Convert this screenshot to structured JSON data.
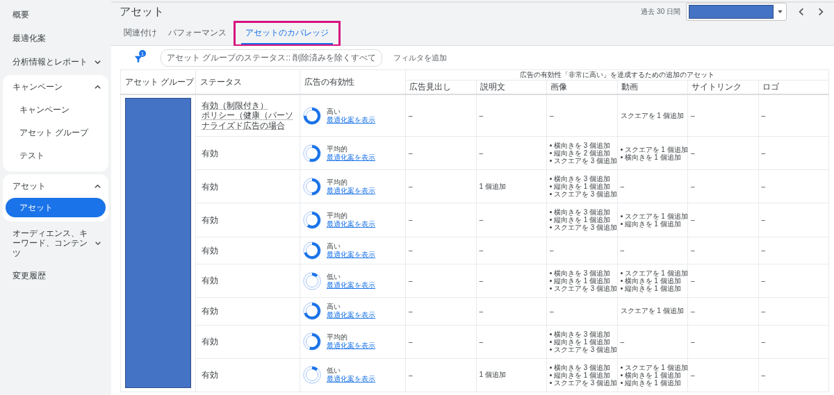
{
  "sidebar": {
    "items": [
      {
        "label": "概要",
        "kind": "link"
      },
      {
        "label": "最適化案",
        "kind": "link"
      },
      {
        "label": "分析情報とレポート",
        "kind": "section",
        "expanded": false
      },
      {
        "label": "キャンペーン",
        "kind": "section",
        "expanded": true,
        "children": [
          {
            "label": "キャンペーン",
            "selected": false
          },
          {
            "label": "アセット グループ",
            "selected": false
          },
          {
            "label": "テスト",
            "selected": false
          }
        ]
      },
      {
        "label": "アセット",
        "kind": "section",
        "expanded": true,
        "children": [
          {
            "label": "アセット",
            "selected": true
          }
        ]
      },
      {
        "label": "オーディエンス、キーワード、コンテンツ",
        "kind": "section",
        "expanded": false
      },
      {
        "label": "変更履歴",
        "kind": "link"
      }
    ]
  },
  "header": {
    "title": "アセット",
    "date_label": "過去 30 日間",
    "date_redacted": true
  },
  "tabs": [
    {
      "label": "関連付け",
      "selected": false,
      "highlighted": false
    },
    {
      "label": "パフォーマンス",
      "selected": false,
      "highlighted": false
    },
    {
      "label": "アセットのカバレッジ",
      "selected": true,
      "highlighted": true
    }
  ],
  "filters": {
    "count": "1",
    "chip": "アセット グループのステータス:: 削除済みを除くすべて",
    "add": "フィルタを追加"
  },
  "table": {
    "columns": [
      "アセット グループ",
      "ステータス",
      "広告の有効性"
    ],
    "group_header": "広告の有効性「非常に高い」を達成するための追加のアセット",
    "sub_columns": [
      "広告見出し",
      "説明文",
      "画像",
      "動画",
      "サイトリンク",
      "ロゴ"
    ],
    "asset_group_redacted": true,
    "rows": [
      {
        "limited": true,
        "status": [
          "有効（制限付き）",
          "ポリシー（健康（パーソナライズド広告の場合"
        ],
        "effectiveness": {
          "rating": "高い",
          "level": 0.75,
          "link": "最適化案を表示"
        },
        "cells": [
          {
            "kind": "text",
            "text": "–"
          },
          {
            "kind": "text",
            "text": "–"
          },
          {
            "kind": "text",
            "text": "–"
          },
          {
            "kind": "text",
            "text": "スクエアを 1 個追加"
          },
          {
            "kind": "text",
            "text": "–"
          },
          {
            "kind": "text",
            "text": "–"
          }
        ]
      },
      {
        "limited": false,
        "status": [
          "有効"
        ],
        "effectiveness": {
          "rating": "平均的",
          "level": 0.55,
          "link": "最適化案を表示"
        },
        "cells": [
          {
            "kind": "text",
            "text": "–"
          },
          {
            "kind": "text",
            "text": "–"
          },
          {
            "kind": "list",
            "items": [
              "横向きを 3 個追加",
              "縦向きを 2 個追加",
              "スクエアを 3 個追加"
            ]
          },
          {
            "kind": "list",
            "items": [
              "スクエアを 1 個追加",
              "横向きを 1 個追加"
            ]
          },
          {
            "kind": "text",
            "text": "–"
          },
          {
            "kind": "text",
            "text": "–"
          }
        ]
      },
      {
        "limited": false,
        "status": [
          "有効"
        ],
        "effectiveness": {
          "rating": "平均的",
          "level": 0.5,
          "link": "最適化案を表示"
        },
        "cells": [
          {
            "kind": "text",
            "text": "–"
          },
          {
            "kind": "text",
            "text": "1 個追加"
          },
          {
            "kind": "list",
            "items": [
              "横向きを 3 個追加",
              "縦向きを 1 個追加",
              "スクエアを 3 個追加"
            ]
          },
          {
            "kind": "text",
            "text": "–"
          },
          {
            "kind": "text",
            "text": "–"
          },
          {
            "kind": "text",
            "text": "–"
          }
        ]
      },
      {
        "limited": false,
        "status": [
          "有効"
        ],
        "effectiveness": {
          "rating": "平均的",
          "level": 0.6,
          "link": "最適化案を表示"
        },
        "cells": [
          {
            "kind": "text",
            "text": "–"
          },
          {
            "kind": "text",
            "text": "–"
          },
          {
            "kind": "list",
            "items": [
              "横向きを 3 個追加",
              "縦向きを 1 個追加",
              "スクエアを 3 個追加"
            ]
          },
          {
            "kind": "list",
            "items": [
              "スクエアを 1 個追加",
              "縦向きを 1 個追加"
            ]
          },
          {
            "kind": "text",
            "text": "–"
          },
          {
            "kind": "text",
            "text": "–"
          }
        ]
      },
      {
        "limited": false,
        "status": [
          "有効"
        ],
        "effectiveness": {
          "rating": "高い",
          "level": 0.7,
          "link": "最適化案を表示"
        },
        "cells": [
          {
            "kind": "text",
            "text": "–"
          },
          {
            "kind": "text",
            "text": "–"
          },
          {
            "kind": "text",
            "text": "–"
          },
          {
            "kind": "text",
            "text": "–"
          },
          {
            "kind": "text",
            "text": "–"
          },
          {
            "kind": "text",
            "text": "–"
          }
        ]
      },
      {
        "limited": false,
        "status": [
          "有効"
        ],
        "effectiveness": {
          "rating": "低い",
          "level": 0.12,
          "link": "最適化案を表示"
        },
        "cells": [
          {
            "kind": "text",
            "text": "–"
          },
          {
            "kind": "text",
            "text": "–"
          },
          {
            "kind": "list",
            "items": [
              "横向きを 3 個追加",
              "縦向きを 1 個追加",
              "スクエアを 3 個追加"
            ]
          },
          {
            "kind": "list",
            "items": [
              "スクエアを 1 個追加",
              "横向きを 1 個追加",
              "縦向きを 1 個追加"
            ]
          },
          {
            "kind": "text",
            "text": "–"
          },
          {
            "kind": "text",
            "text": "–"
          }
        ]
      },
      {
        "limited": false,
        "status": [
          "有効"
        ],
        "effectiveness": {
          "rating": "高い",
          "level": 0.7,
          "link": "最適化案を表示"
        },
        "cells": [
          {
            "kind": "text",
            "text": "–"
          },
          {
            "kind": "text",
            "text": "–"
          },
          {
            "kind": "text",
            "text": "–"
          },
          {
            "kind": "text",
            "text": "スクエアを 1 個追加"
          },
          {
            "kind": "text",
            "text": "–"
          },
          {
            "kind": "text",
            "text": "–"
          }
        ]
      },
      {
        "limited": false,
        "status": [
          "有効"
        ],
        "effectiveness": {
          "rating": "平均的",
          "level": 0.55,
          "link": "最適化案を表示"
        },
        "cells": [
          {
            "kind": "text",
            "text": "–"
          },
          {
            "kind": "text",
            "text": "–"
          },
          {
            "kind": "list",
            "items": [
              "横向きを 3 個追加",
              "縦向きを 1 個追加",
              "スクエアを 3 個追加"
            ]
          },
          {
            "kind": "text",
            "text": "–"
          },
          {
            "kind": "text",
            "text": "–"
          },
          {
            "kind": "text",
            "text": "–"
          }
        ]
      },
      {
        "limited": false,
        "status": [
          "有効"
        ],
        "effectiveness": {
          "rating": "低い",
          "level": 0.12,
          "link": "最適化案を表示"
        },
        "cells": [
          {
            "kind": "text",
            "text": "–"
          },
          {
            "kind": "text",
            "text": "1 個追加"
          },
          {
            "kind": "list",
            "items": [
              "横向きを 3 個追加",
              "縦向きを 1 個追加",
              "スクエアを 3 個追加"
            ]
          },
          {
            "kind": "list",
            "items": [
              "スクエアを 1 個追加",
              "横向きを 1 個追加",
              "縦向きを 1 個追加"
            ]
          },
          {
            "kind": "text",
            "text": "–"
          },
          {
            "kind": "text",
            "text": "–"
          }
        ]
      }
    ]
  }
}
